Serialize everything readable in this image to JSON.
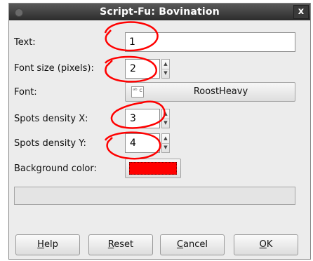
{
  "window": {
    "title": "Script-Fu: Bovination",
    "close_glyph": "x"
  },
  "fields": {
    "text_label": "Text:",
    "text_value": "1",
    "font_size_label": "Font size (pixels):",
    "font_size_value": "2",
    "font_label": "Font:",
    "font_value": "RoostHeavy",
    "font_icon_glyph": "ᵃᵇ c",
    "spots_x_label": "Spots density X:",
    "spots_x_value": "3",
    "spots_y_label": "Spots density Y:",
    "spots_y_value": "4",
    "bg_color_label": "Background color:",
    "bg_color": "#ff0000"
  },
  "spin_glyphs": {
    "up": "▲",
    "down": "▼"
  },
  "buttons": {
    "help_mnemonic": "H",
    "help_rest": "elp",
    "reset_mnemonic": "R",
    "reset_rest": "eset",
    "cancel_mnemonic": "C",
    "cancel_rest": "ancel",
    "ok_mnemonic": "O",
    "ok_rest": "K"
  },
  "annotation_color": "#ff0000"
}
